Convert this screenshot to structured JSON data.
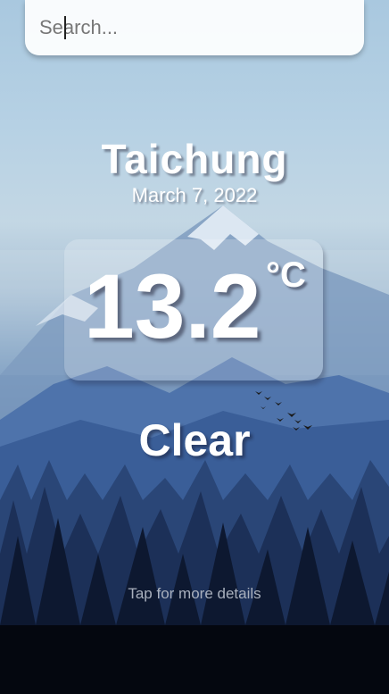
{
  "search": {
    "placeholder": "Search...",
    "value": ""
  },
  "location": {
    "city": "Taichung",
    "date": "March 7, 2022"
  },
  "weather": {
    "temperature": "13.2",
    "unit": "°C",
    "condition": "Clear"
  },
  "footer": {
    "hint": "Tap for more details"
  },
  "colors": {
    "text": "#ffffff",
    "hint_text": "#a9b0bd",
    "sky_top": "#a9c8df",
    "forest_dark": "#04070f"
  }
}
